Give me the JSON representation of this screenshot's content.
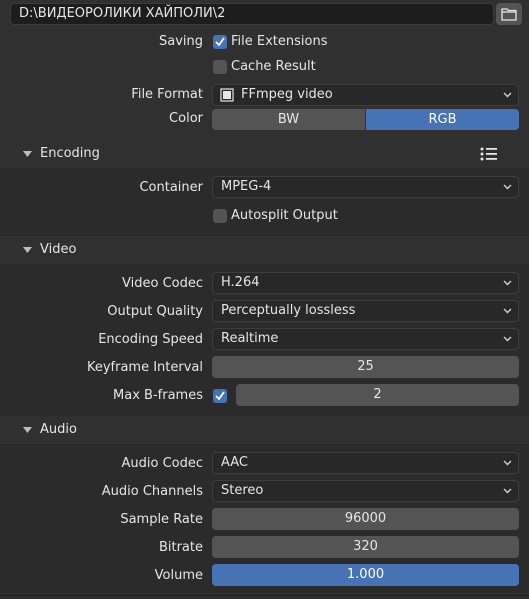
{
  "output": {
    "path": "D:\\ВИДЕОРОЛИКИ ХАЙПОЛИ\\2",
    "saving_label": "Saving",
    "file_extensions_label": "File Extensions",
    "file_extensions_checked": true,
    "cache_result_label": "Cache Result",
    "cache_result_checked": false,
    "file_format_label": "File Format",
    "file_format_value": "FFmpeg video",
    "color_label": "Color",
    "color_options": [
      "BW",
      "RGB"
    ],
    "color_selected": "RGB"
  },
  "encoding": {
    "title": "Encoding",
    "container_label": "Container",
    "container_value": "MPEG-4",
    "autosplit_label": "Autosplit Output",
    "autosplit_checked": false
  },
  "video": {
    "title": "Video",
    "codec_label": "Video Codec",
    "codec_value": "H.264",
    "quality_label": "Output Quality",
    "quality_value": "Perceptually lossless",
    "speed_label": "Encoding Speed",
    "speed_value": "Realtime",
    "keyframe_label": "Keyframe Interval",
    "keyframe_value": "25",
    "bframes_label": "Max B-frames",
    "bframes_checked": true,
    "bframes_value": "2"
  },
  "audio": {
    "title": "Audio",
    "codec_label": "Audio Codec",
    "codec_value": "AAC",
    "channels_label": "Audio Channels",
    "channels_value": "Stereo",
    "sample_rate_label": "Sample Rate",
    "sample_rate_value": "96000",
    "bitrate_label": "Bitrate",
    "bitrate_value": "320",
    "volume_label": "Volume",
    "volume_value": "1.000"
  },
  "colors": {
    "accent": "#4772b3",
    "background": "#303030",
    "panel": "#2b2b2b",
    "field": "#545454"
  }
}
